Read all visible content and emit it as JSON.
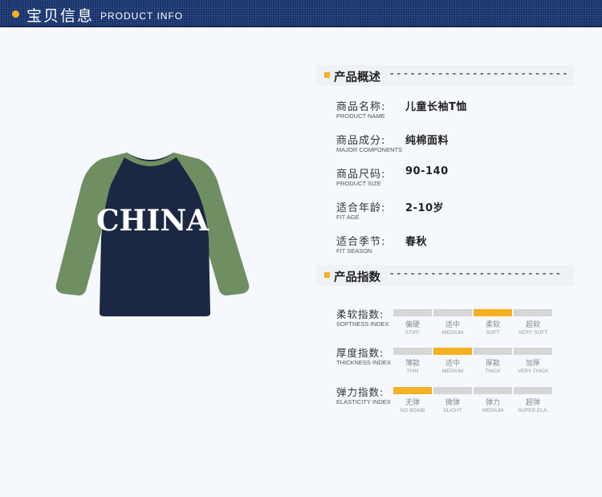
{
  "header": {
    "title": "宝贝信息",
    "subtitle": "PRODUCT INFO"
  },
  "shirt": {
    "print_text": "CHINA",
    "body_color": "#1b2843",
    "sleeve_color": "#6f8e62"
  },
  "overview": {
    "label": "产品概述",
    "dashes": "--------------------------"
  },
  "specs": [
    {
      "cn": "商品名称:",
      "en": "PRODUCT NAME",
      "value": "儿童长袖T恤"
    },
    {
      "cn": "商品成分:",
      "en": "MAJOR COMPONENTS",
      "value": "纯棉面料"
    },
    {
      "cn": "商品尺码:",
      "en": "PRODUCT SIZE",
      "value": "90-140"
    },
    {
      "cn": "适合年龄:",
      "en": "FIT AGE",
      "value": "2-10岁"
    },
    {
      "cn": "适合季节:",
      "en": "FIT SEASON",
      "value": "春秋"
    }
  ],
  "index_section": {
    "label": "产品指数",
    "dashes": "-------------------------"
  },
  "indexes": [
    {
      "cn": "柔软指数:",
      "en": "SOFTNESS INDEX",
      "selected": 2,
      "levels": [
        {
          "cn": "偏硬",
          "en": "STIFF"
        },
        {
          "cn": "适中",
          "en": "MEDIUM"
        },
        {
          "cn": "柔软",
          "en": "SOFT"
        },
        {
          "cn": "超软",
          "en": "VERY SOFT"
        }
      ]
    },
    {
      "cn": "厚度指数:",
      "en": "THICKNESS INDEX",
      "selected": 1,
      "levels": [
        {
          "cn": "薄款",
          "en": "THIN"
        },
        {
          "cn": "适中",
          "en": "MEDIUM"
        },
        {
          "cn": "厚款",
          "en": "THICK"
        },
        {
          "cn": "加厚",
          "en": "VERY THICK"
        }
      ]
    },
    {
      "cn": "弹力指数:",
      "en": "ELASTICITY INDEX",
      "selected": 0,
      "levels": [
        {
          "cn": "无弹",
          "en": "NO BOMB"
        },
        {
          "cn": "微弹",
          "en": "SLIGHT"
        },
        {
          "cn": "弹力",
          "en": "MEDIUM"
        },
        {
          "cn": "超弹",
          "en": "SUPER ELA."
        }
      ]
    }
  ],
  "colors": {
    "header_bg": "#15306a",
    "accent": "#f4b223",
    "inactive_bar": "#d6d6d6"
  }
}
